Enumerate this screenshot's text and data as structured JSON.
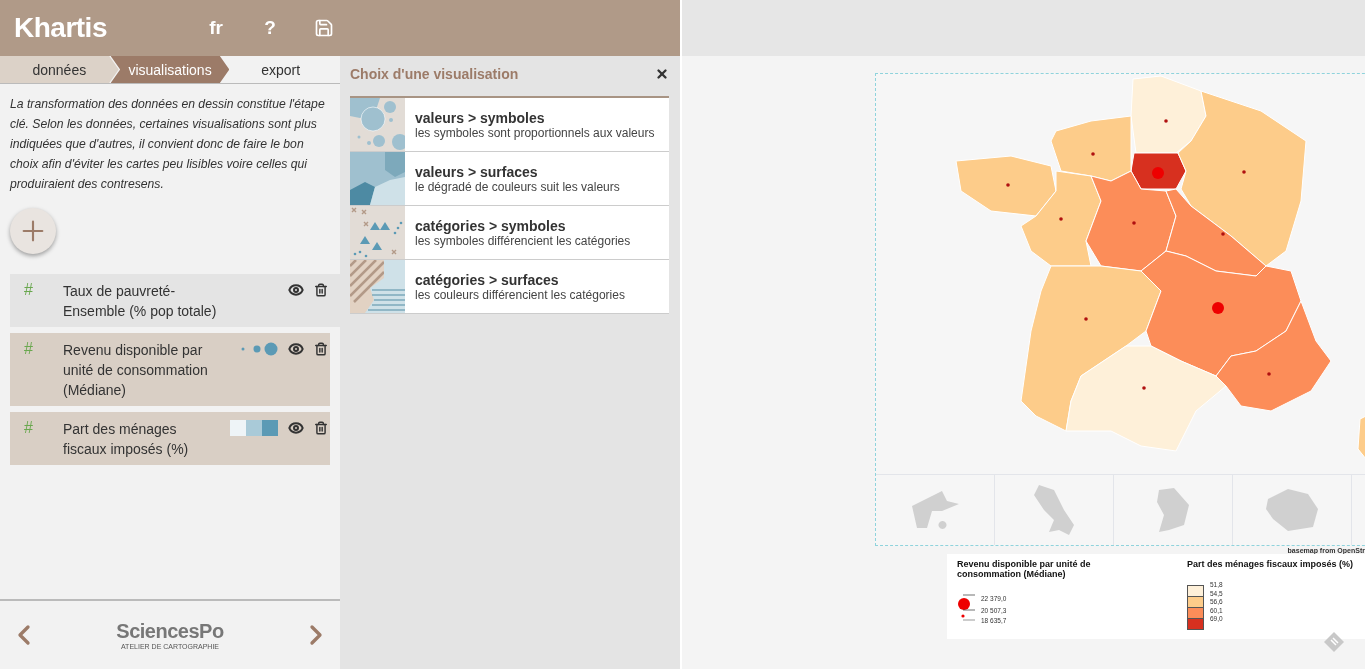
{
  "header": {
    "logo": "Khartis",
    "language": "fr",
    "help": "?"
  },
  "steps": [
    {
      "label": "données",
      "selected": false,
      "visited": true
    },
    {
      "label": "visualisations",
      "selected": true,
      "visited": true
    },
    {
      "label": "export",
      "selected": false,
      "visited": false
    }
  ],
  "intro": "La transformation des données en dessin constitue l'étape clé. Selon les données, certaines visualisations sont plus indiquées que d'autres, il convient donc de faire le bon choix afin d'éviter les cartes peu lisibles voire celles qui produiraient des contresens.",
  "layers": [
    {
      "type_mark": "#",
      "name": "Taux de pauvreté-Ensemble (% pop totale)",
      "kind": "none"
    },
    {
      "type_mark": "#",
      "name": "Revenu disponible par unité de consommation (Médiane)",
      "kind": "symbols"
    },
    {
      "type_mark": "#",
      "name": "Part des ménages fiscaux imposés (%)",
      "kind": "surfaces"
    }
  ],
  "footer": {
    "brand": "SciencesPo",
    "subtitle": "ATELIER DE CARTOGRAPHIE"
  },
  "chooser": {
    "title": "Choix d'une visualisation",
    "options": [
      {
        "kind": "value-symbols",
        "title": "valeurs > symboles",
        "description": "les symboles sont proportionnels aux valeurs"
      },
      {
        "kind": "value-surfaces",
        "title": "valeurs > surfaces",
        "description": "le dégradé de couleurs suit les valeurs"
      },
      {
        "kind": "category-symbols",
        "title": "catégories > symboles",
        "description": "les symboles différencient les catégories"
      },
      {
        "kind": "category-surfaces",
        "title": "catégories > surfaces",
        "description": "les couleurs différencient les catégories"
      }
    ]
  },
  "map": {
    "attribution": "basemap from OpenStr"
  },
  "symbol_legend": {
    "title": "Revenu disponible par unité de consommation (Médiane)",
    "values": [
      "22 379,0",
      "20 507,3",
      "18 635,7"
    ]
  },
  "color_legend": {
    "title": "Part des ménages fiscaux imposés (%)",
    "classes": [
      {
        "color": "#fef0d9"
      },
      {
        "color": "#fdcc8a"
      },
      {
        "color": "#fc8d59"
      },
      {
        "color": "#d7301f"
      }
    ],
    "breaks": [
      "51,8",
      "54,5",
      "56,6",
      "60,1",
      "69,0"
    ]
  }
}
